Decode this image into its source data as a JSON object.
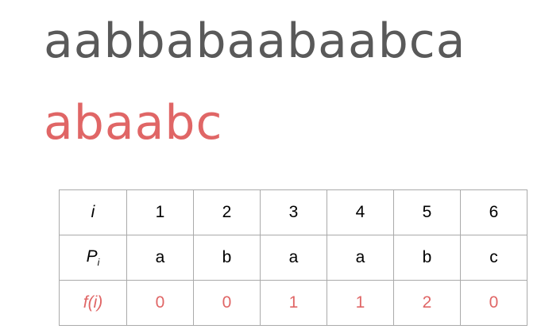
{
  "text_string": "aabbabaabaabca",
  "pattern_string": "abaabc",
  "table": {
    "row_headers": {
      "i": "i",
      "p_main": "P",
      "p_sub": "i",
      "f": "f(i)"
    },
    "i_values": [
      "1",
      "2",
      "3",
      "4",
      "5",
      "6"
    ],
    "p_values": [
      "a",
      "b",
      "a",
      "a",
      "b",
      "c"
    ],
    "f_values": [
      "0",
      "0",
      "1",
      "1",
      "2",
      "0"
    ]
  },
  "colors": {
    "text_gray": "#595959",
    "accent_red": "#e06666",
    "border_gray": "#aaaaaa"
  }
}
